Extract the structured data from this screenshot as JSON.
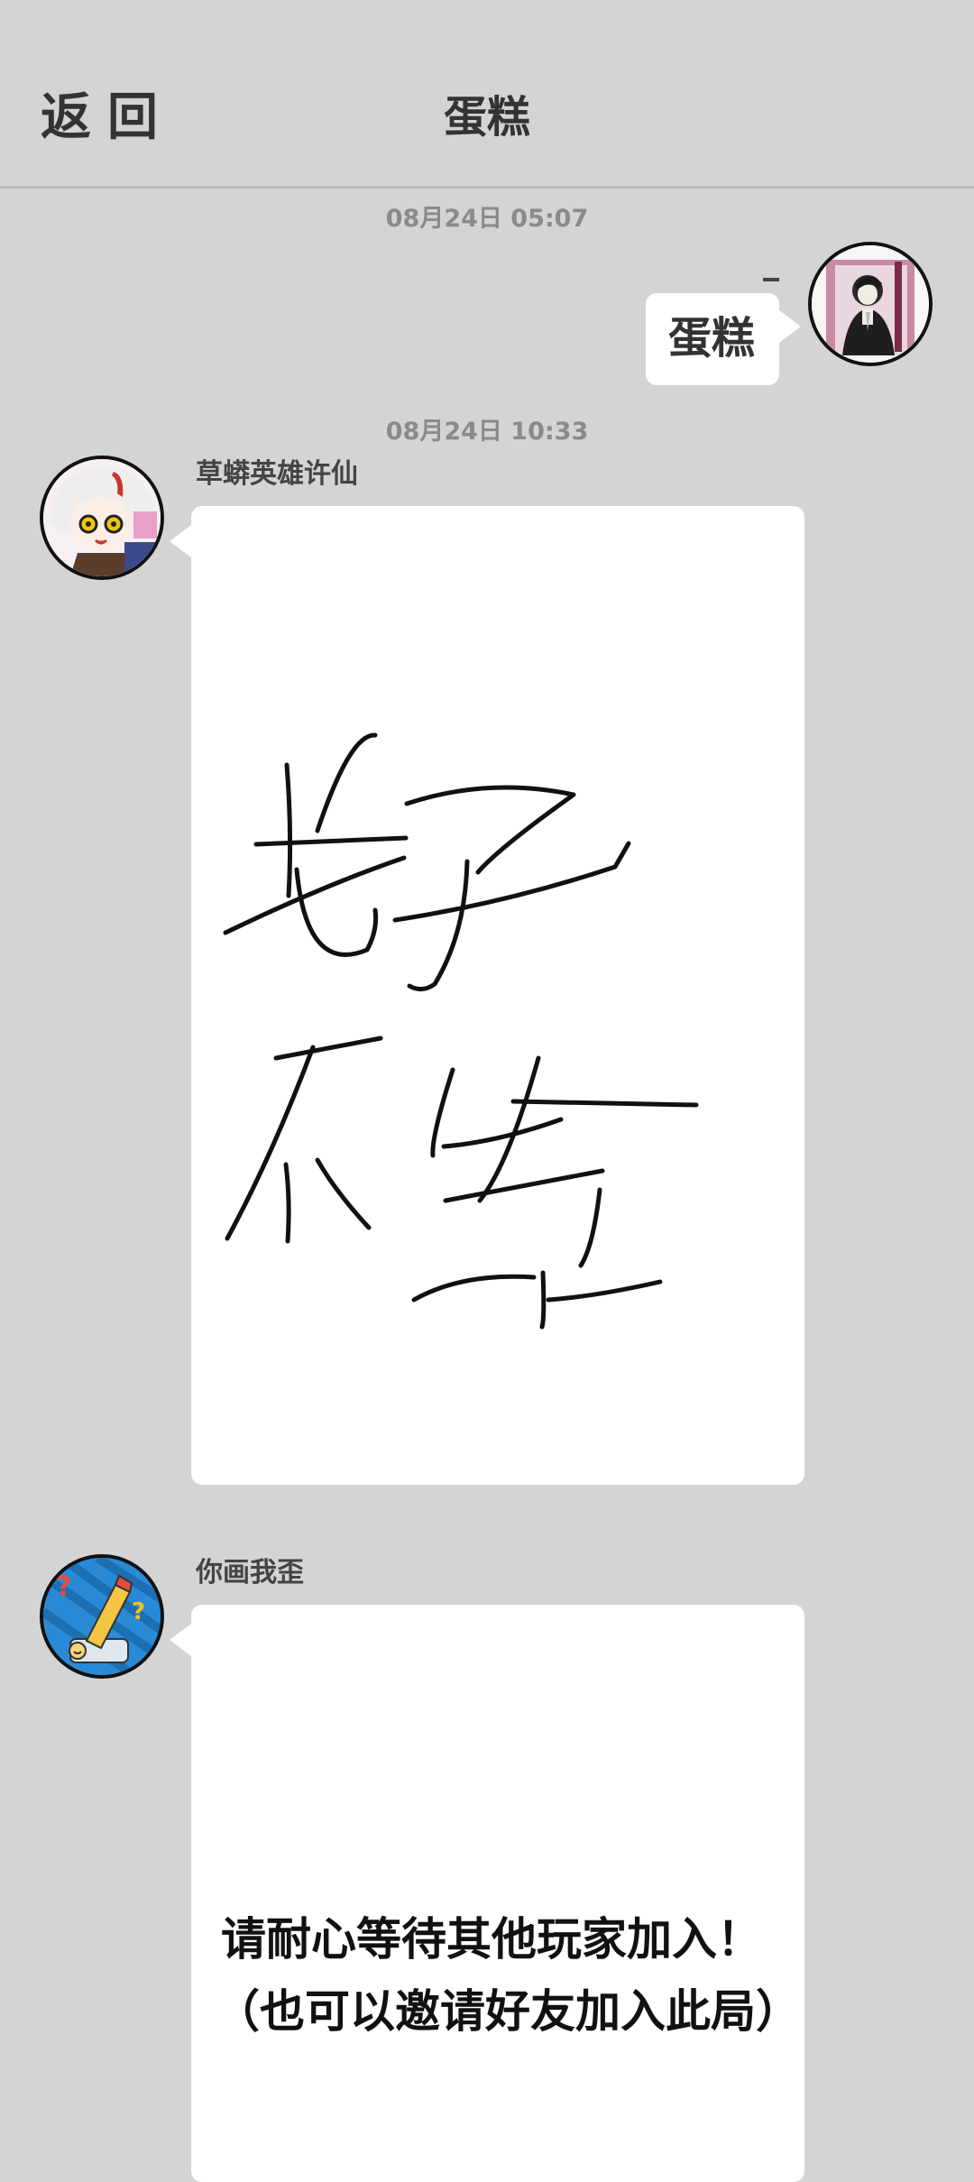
{
  "header": {
    "back_label": "返回",
    "title": "蛋糕"
  },
  "messages": [
    {
      "timestamp": "08月24日  05:07",
      "text": "蛋糕",
      "marker": "–"
    },
    {
      "timestamp": "08月24日  10:33",
      "sender": "草蟒英雄许仙"
    },
    {
      "sender": "你画我歪",
      "text_line1": "请耐心等待其他玩家加入！",
      "text_line2": "（也可以邀请好友加入此局）"
    }
  ],
  "colors": {
    "background": "#d4d4d4",
    "bubble": "#ffffff",
    "text": "#333333",
    "timestamp": "#8a8a8a"
  }
}
